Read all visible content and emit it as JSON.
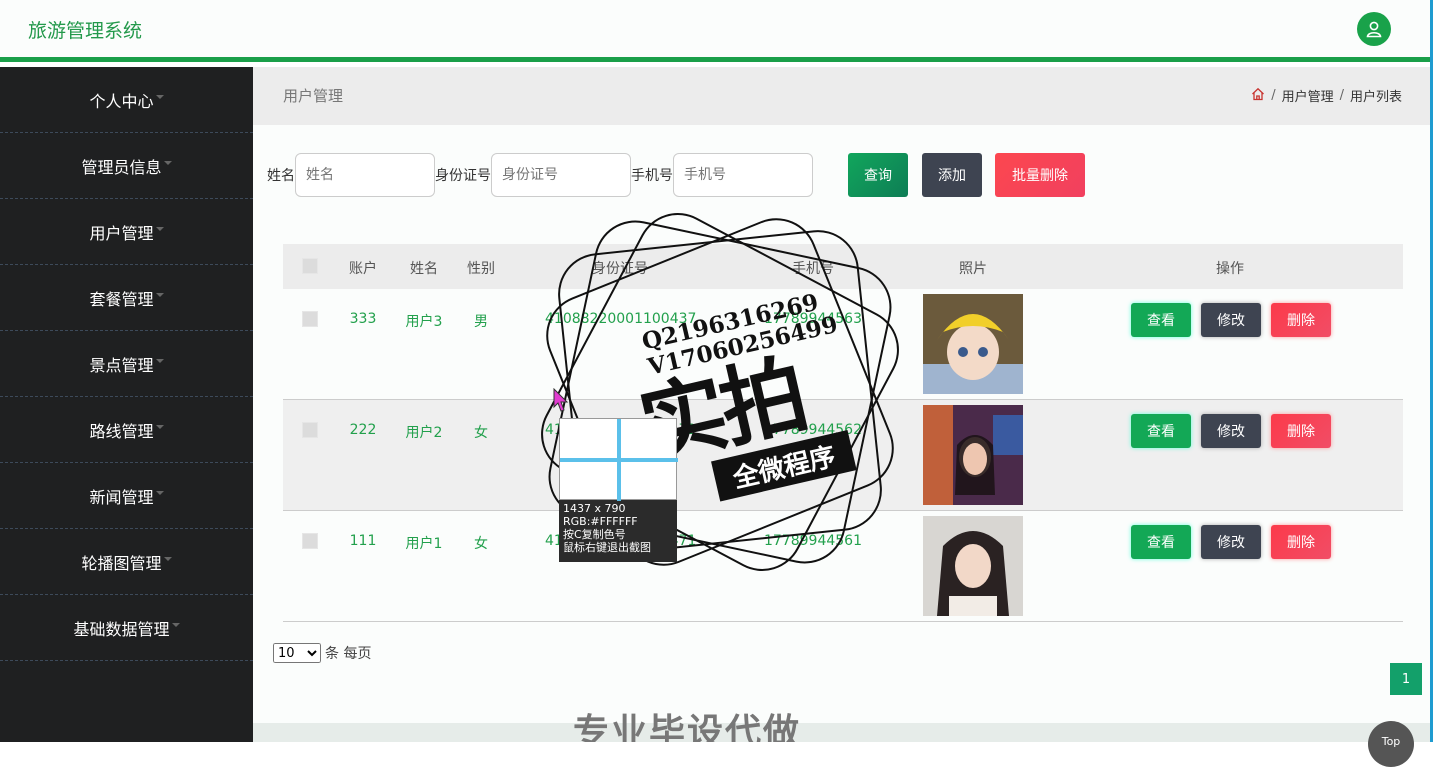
{
  "app": {
    "title": "旅游管理系统"
  },
  "sidebar": {
    "items": [
      {
        "label": "个人中心"
      },
      {
        "label": "管理员信息"
      },
      {
        "label": "用户管理"
      },
      {
        "label": "套餐管理"
      },
      {
        "label": "景点管理"
      },
      {
        "label": "路线管理"
      },
      {
        "label": "新闻管理"
      },
      {
        "label": "轮播图管理"
      },
      {
        "label": "基础数据管理"
      }
    ]
  },
  "header": {
    "page_title": "用户管理",
    "breadcrumb": [
      "用户管理",
      "用户列表"
    ]
  },
  "search": {
    "name_label": "姓名",
    "name_placeholder": "姓名",
    "id_label": "身份证号",
    "id_placeholder": "身份证号",
    "phone_label": "手机号",
    "phone_placeholder": "手机号",
    "query_label": "查询",
    "add_label": "添加",
    "batch_delete_label": "批量删除"
  },
  "table": {
    "columns": [
      "账户",
      "姓名",
      "性别",
      "身份证号",
      "手机号",
      "照片",
      "操作"
    ],
    "rows": [
      {
        "account": "333",
        "name": "用户3",
        "gender": "男",
        "id_number": "41088220001100437",
        "phone": "17789944563"
      },
      {
        "account": "222",
        "name": "用户2",
        "gender": "女",
        "id_number": "41088220001100472",
        "phone": "17789944562"
      },
      {
        "account": "111",
        "name": "用户1",
        "gender": "女",
        "id_number": "41088220001100471",
        "phone": "17789944561"
      }
    ],
    "actions": {
      "view": "查看",
      "edit": "修改",
      "delete": "删除"
    }
  },
  "pagination": {
    "page_size": "10",
    "per_page_label": "条 每页",
    "current_page": "1"
  },
  "watermark": {
    "qq": "Q2196316269",
    "vx": "V17060256499",
    "big": "实拍",
    "banner": "全微程序",
    "footer": "专业毕设代做"
  },
  "color_picker": {
    "size": "1437 x 790",
    "rgb": "RGB:#FFFFFF",
    "hint1": "按C复制色号",
    "hint2": "鼠标右键退出截图"
  },
  "top_button": "Top",
  "colors": {
    "brand": "#1a9f49",
    "sidebar": "#1f2021",
    "danger": "#fc474f",
    "dark": "#3e4451"
  }
}
